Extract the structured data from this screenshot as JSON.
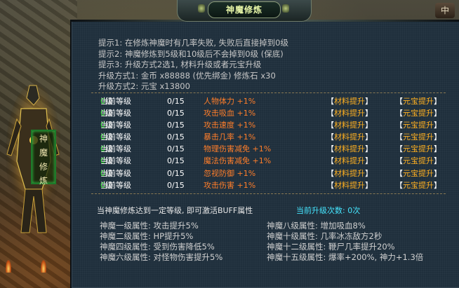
{
  "window": {
    "title": "神魔修炼",
    "corner_label": "中"
  },
  "side_tab": {
    "chars": [
      "神",
      "魔",
      "修",
      "炼"
    ]
  },
  "tips": [
    "提示1: 在修炼神魔时有几率失败, 失败后直接掉到0级",
    "提示2: 神魔修炼到5级和10级后不会掉到0级 (保底)",
    "提示3: 升级方式2选1, 材料升级或者元宝升级",
    "升级方式1: 金币 x88888 (优先绑金)   修炼石 x30",
    "升级方式2: 元宝 x13800"
  ],
  "upgrade_rows": [
    {
      "level_prefix": "当前等级",
      "level": "0",
      "level_suffix": "级",
      "progress": "0/15",
      "attr": "人物体力",
      "bonus": "+1%",
      "mat_btn": "材料提升",
      "yb_btn": "元宝提升"
    },
    {
      "level_prefix": "当前等级",
      "level": "0",
      "level_suffix": "级",
      "progress": "0/15",
      "attr": "攻击吸血",
      "bonus": "+1%",
      "mat_btn": "材料提升",
      "yb_btn": "元宝提升"
    },
    {
      "level_prefix": "当前等级",
      "level": "0",
      "level_suffix": "级",
      "progress": "0/15",
      "attr": "攻击速度",
      "bonus": "+1%",
      "mat_btn": "材料提升",
      "yb_btn": "元宝提升"
    },
    {
      "level_prefix": "当前等级",
      "level": "0",
      "level_suffix": "级",
      "progress": "0/15",
      "attr": "暴击几率",
      "bonus": "+1%",
      "mat_btn": "材料提升",
      "yb_btn": "元宝提升"
    },
    {
      "level_prefix": "当前等级",
      "level": "0",
      "level_suffix": "级",
      "progress": "0/15",
      "attr": "物理伤害减免",
      "bonus": "+1%",
      "mat_btn": "材料提升",
      "yb_btn": "元宝提升"
    },
    {
      "level_prefix": "当前等级",
      "level": "0",
      "level_suffix": "级",
      "progress": "0/15",
      "attr": "魔法伤害减免",
      "bonus": "+1%",
      "mat_btn": "材料提升",
      "yb_btn": "元宝提升"
    },
    {
      "level_prefix": "当前等级",
      "level": "0",
      "level_suffix": "级",
      "progress": "0/15",
      "attr": "忽视防御",
      "bonus": "+1%",
      "mat_btn": "材料提升",
      "yb_btn": "元宝提升"
    },
    {
      "level_prefix": "当前等级",
      "level": "0",
      "level_suffix": "级",
      "progress": "0/15",
      "attr": "攻击伤害",
      "bonus": "+1%",
      "mat_btn": "材料提升",
      "yb_btn": "元宝提升"
    }
  ],
  "buff_info": "当神魔修炼达到一定等级, 即可激活BUFF属性",
  "upgrade_count": "当前升级次数: 0次",
  "attributes_left": [
    "神魔一级属性: 攻击提升5%",
    "神魔二级属性: HP提升5%",
    "神魔四级属性: 受到伤害降低5%",
    "神魔六级属性: 对怪物伤害提升5%"
  ],
  "attributes_right": [
    "神魔八级属性: 增加吸血8%",
    "神魔十级属性: 几率冰冻敌方2秒",
    "神魔十二级属性: 鞭尸几率提升20%",
    "神魔十五级属性: 爆率+200%, 神力+1.3倍"
  ],
  "colors": {
    "panel_bg": "#1f2f3c",
    "level_zero": "#28e028",
    "attr_orange": "#ff7e2a",
    "button_gold": "#ffb020",
    "count_cyan": "#45e6ff"
  }
}
